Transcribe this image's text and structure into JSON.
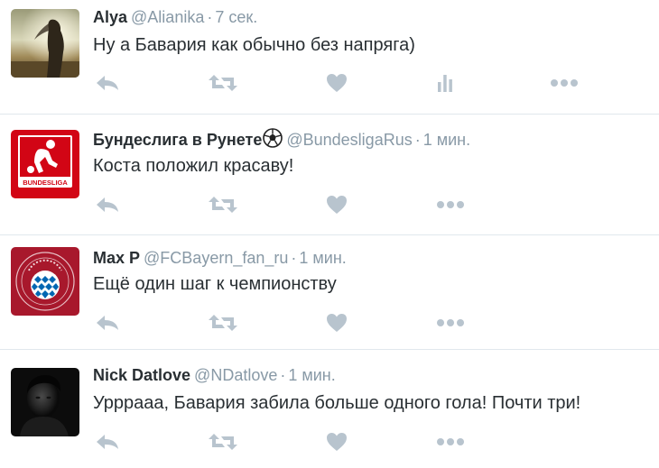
{
  "tweets": [
    {
      "fullname": "Alya",
      "handle": "@Alianika",
      "separator": "·",
      "time": "7 сек.",
      "text": "Ну а Бавария как обычно без напряга)",
      "avatar": "woman-silhouette-photo",
      "has_analytics": true
    },
    {
      "fullname": "Бундеслига в Рунете",
      "handle": "@BundesligaRus",
      "separator": "·",
      "time": "1 мин.",
      "text": "Коста положил красаву!",
      "avatar": "bundesliga-logo",
      "avatar_logo_text": "BUNDESLIGA",
      "badge_icon": "soccer-ball-icon",
      "has_analytics": false
    },
    {
      "fullname": "Max P",
      "handle": "@FCBayern_fan_ru",
      "separator": "·",
      "time": "1 мин.",
      "text": "Ещё один шаг к чемпионству",
      "avatar": "fc-bayern-crest",
      "has_analytics": false
    },
    {
      "fullname": "Nick Datlove",
      "handle": "@NDatlove",
      "separator": "·",
      "time": "1 мин.",
      "text": "Урррааа, Бавария забила больше одного гола! Почти три!",
      "avatar": "dark-portrait-photo",
      "has_analytics": false
    }
  ],
  "actions": [
    "reply-icon",
    "retweet-icon",
    "like-icon",
    "analytics-icon",
    "more-icon"
  ],
  "colors": {
    "action_gray": "#b8c4ce",
    "meta_gray": "#8899a6",
    "separator": "#e1e8ed",
    "bundesliga_red": "#d20515",
    "bayern_red": "#a8182c",
    "bayern_blue": "#0066b2"
  }
}
